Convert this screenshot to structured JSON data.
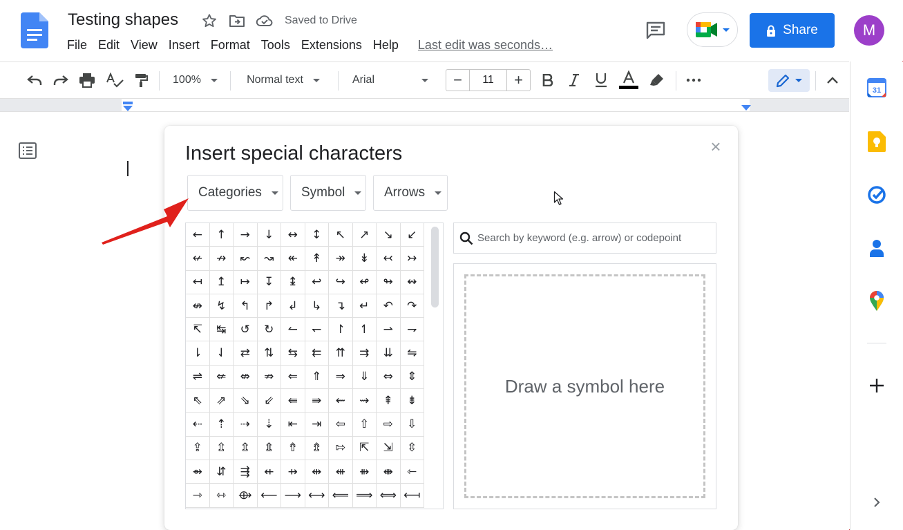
{
  "document": {
    "title": "Testing shapes",
    "saved_status": "Saved to Drive"
  },
  "menu": {
    "items": [
      "File",
      "Edit",
      "View",
      "Insert",
      "Format",
      "Tools",
      "Extensions",
      "Help"
    ],
    "last_edit": "Last edit was seconds…"
  },
  "header": {
    "share_label": "Share",
    "avatar_initial": "M"
  },
  "toolbar": {
    "zoom": "100%",
    "style": "Normal text",
    "font": "Arial",
    "font_size": "11",
    "minus": "−",
    "plus": "+"
  },
  "dialog": {
    "title": "Insert special characters",
    "close": "×",
    "dropdowns": [
      "Categories",
      "Symbol",
      "Arrows"
    ],
    "search_placeholder": "Search by keyword (e.g. arrow) or codepoint",
    "draw_prompt": "Draw a symbol here",
    "characters": [
      "←",
      "↑",
      "→",
      "↓",
      "↔",
      "↕",
      "↖",
      "↗",
      "↘",
      "↙",
      "↚",
      "↛",
      "↜",
      "↝",
      "↞",
      "↟",
      "↠",
      "↡",
      "↢",
      "↣",
      "↤",
      "↥",
      "↦",
      "↧",
      "↨",
      "↩",
      "↪",
      "↫",
      "↬",
      "↭",
      "↮",
      "↯",
      "↰",
      "↱",
      "↲",
      "↳",
      "↴",
      "↵",
      "↶",
      "↷",
      "↸",
      "↹",
      "↺",
      "↻",
      "↼",
      "↽",
      "↾",
      "↿",
      "⇀",
      "⇁",
      "⇂",
      "⇃",
      "⇄",
      "⇅",
      "⇆",
      "⇇",
      "⇈",
      "⇉",
      "⇊",
      "⇋",
      "⇌",
      "⇍",
      "⇎",
      "⇏",
      "⇐",
      "⇑",
      "⇒",
      "⇓",
      "⇔",
      "⇕",
      "⇖",
      "⇗",
      "⇘",
      "⇙",
      "⇚",
      "⇛",
      "⇜",
      "⇝",
      "⇞",
      "⇟",
      "⇠",
      "⇡",
      "⇢",
      "⇣",
      "⇤",
      "⇥",
      "⇦",
      "⇧",
      "⇨",
      "⇩",
      "⇪",
      "⇫",
      "⇬",
      "⇭",
      "⇮",
      "⇯",
      "⇰",
      "⇱",
      "⇲",
      "⇳",
      "⇴",
      "⇵",
      "⇶",
      "⇷",
      "⇸",
      "⇹",
      "⇺",
      "⇻",
      "⇼",
      "⇽",
      "⇾",
      "⇿",
      "⟴",
      "⟵",
      "⟶",
      "⟷",
      "⟸",
      "⟹",
      "⟺",
      "⟻"
    ]
  },
  "colors": {
    "share_blue": "#1a73e8",
    "avatar_purple": "#9c3fc9",
    "annotation_red": "#e0211c"
  },
  "icons": {
    "docs_logo": "docs-logo-icon",
    "star": "star-icon",
    "move": "move-to-folder-icon",
    "cloud": "cloud-saved-icon",
    "comments": "comment-icon",
    "meet": "meet-icon",
    "lock": "lock-icon",
    "calendar": "calendar-icon",
    "keep": "keep-icon",
    "tasks": "tasks-icon",
    "contacts": "contacts-icon",
    "maps": "maps-icon"
  }
}
